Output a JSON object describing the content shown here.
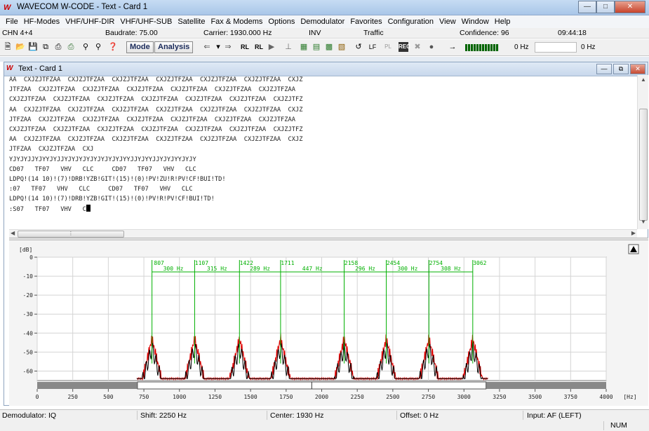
{
  "window": {
    "title": "WAVECOM W-CODE - Text - Card 1"
  },
  "menu": [
    "File",
    "HF-Modes",
    "VHF/UHF-DIR",
    "VHF/UHF-SUB",
    "Satellite",
    "Fax & Modems",
    "Options",
    "Demodulator",
    "Favorites",
    "Configuration",
    "View",
    "Window",
    "Help"
  ],
  "info": {
    "channel": "CHN 4+4",
    "baudrate": "Baudrate: 75.00",
    "carrier": "Carrier: 1930.000 Hz",
    "inv": "INV",
    "traffic": "Traffic",
    "confidence": "Confidence: 96",
    "time": "09:44:18"
  },
  "toolbar": {
    "mode_label": "Mode",
    "analysis_label": "Analysis",
    "freq1": "0 Hz",
    "freq2": "0 Hz"
  },
  "card": {
    "title": "Text - Card 1"
  },
  "text_lines": [
    "AA  CXJZJTFZAA  CXJZJTFZAA  CXJZJTFZAA  CXJZJTFZAA  CXJZJTFZAA  CXJZJTFZAA  CXJZ",
    "JTFZAA  CXJZJTFZAA  CXJZJTFZAA  CXJZJTFZAA  CXJZJTFZAA  CXJZJTFZAA  CXJZJTFZAA",
    "CXJZJTFZAA  CXJZJTFZAA  CXJZJTFZAA  CXJZJTFZAA  CXJZJTFZAA  CXJZJTFZAA  CXJZJTFZ",
    "AA  CXJZJTFZAA  CXJZJTFZAA  CXJZJTFZAA  CXJZJTFZAA  CXJZJTFZAA  CXJZJTFZAA  CXJZ",
    "JTFZAA  CXJZJTFZAA  CXJZJTFZAA  CXJZJTFZAA  CXJZJTFZAA  CXJZJTFZAA  CXJZJTFZAA",
    "CXJZJTFZAA  CXJZJTFZAA  CXJZJTFZAA  CXJZJTFZAA  CXJZJTFZAA  CXJZJTFZAA  CXJZJTFZ",
    "AA  CXJZJTFZAA  CXJZJTFZAA  CXJZJTFZAA  CXJZJTFZAA  CXJZJTFZAA  CXJZJTFZAA  CXJZ",
    "JTFZAA  CXJZJTFZAA  CXJ",
    "YJYJYJJYJYYJYJJYJYJYJYJYJYJYJYJYYJJYJYYJJYJYJYYJYJY",
    "CD07   TF07   VHV   CLC     CD07   TF07   VHV   CLC",
    "LDPQ!(14 10)!(7)!DRB!YZB!GIT!(15)!(0)!PV!ZU!R!PV!CF!BUI!TD!",
    ":07   TF07   VHV   CLC     CD07   TF07   VHV   CLC",
    "LDPQ!(14 10)!(7)!DRB!YZB!GIT!(15)!(0)!PV!R!PV!CF!BUI!TD!",
    ":S07   TF07   VHV   C"
  ],
  "spectrum": {
    "y_unit": "[dB]",
    "y_ticks": [
      "0",
      "-10",
      "-20",
      "-30",
      "-40",
      "-50",
      "-60"
    ],
    "x_unit": "[Hz]",
    "x_ticks": [
      "0",
      "250",
      "500",
      "750",
      "1000",
      "1250",
      "1500",
      "1750",
      "2000",
      "2250",
      "2500",
      "2750",
      "3000",
      "3250",
      "3500",
      "3750",
      "4000"
    ],
    "markers": [
      "807",
      "1107",
      "1422",
      "1711",
      "2158",
      "2454",
      "2754",
      "3062"
    ],
    "spacings": [
      "300 Hz",
      "315 Hz",
      "289 Hz",
      "447 Hz",
      "296 Hz",
      "300 Hz",
      "308 Hz"
    ],
    "peak_freqs": [
      807,
      1107,
      1422,
      1711,
      2158,
      2454,
      2754,
      3062
    ]
  },
  "status": {
    "demod": "Demodulator: IQ",
    "shift": "Shift: 2250 Hz",
    "center": "Center: 1930 Hz",
    "offset": "Offset: 0 Hz",
    "input": "Input: AF (LEFT)",
    "num": "NUM"
  },
  "colors": {
    "red": "#e00000",
    "green": "#00b000",
    "black": "#000000"
  }
}
